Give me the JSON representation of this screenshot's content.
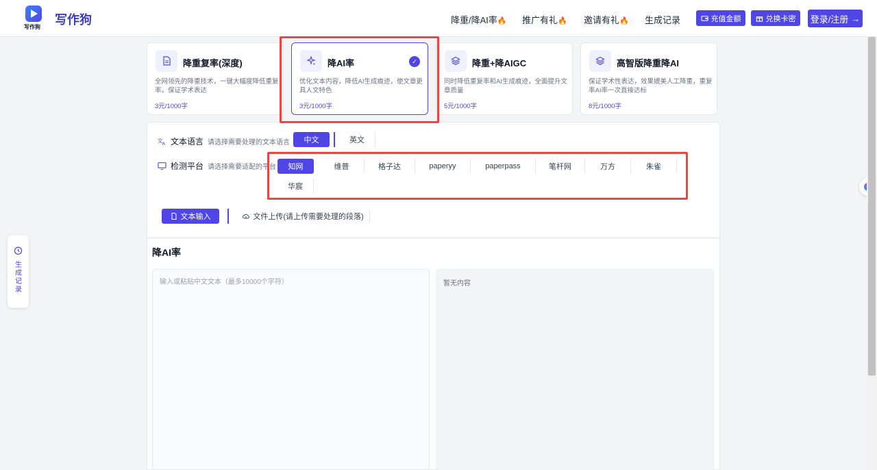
{
  "header": {
    "logo_text": "写作狗",
    "brand": "写作狗",
    "nav": [
      {
        "label": "降重/降AI率"
      },
      {
        "label": "推广有礼"
      },
      {
        "label": "邀请有礼"
      },
      {
        "label": "生成记录"
      }
    ],
    "recharge_label": "充值金额",
    "redeem_label": "兑换卡密",
    "login_label": "登录/注册"
  },
  "cards": [
    {
      "title": "降重复率(深度)",
      "desc": "全网领先的降重技术，一键大幅度降低重复率，保证学术表达",
      "price": "3元/1000字",
      "selected": false
    },
    {
      "title": "降AI率",
      "desc": "优化文本内容，降低AI生成痕迹，使文章更具人文特色",
      "price": "3元/1000字",
      "selected": true
    },
    {
      "title": "降重+降AIGC",
      "desc": "同时降低重复率和AI生成痕迹，全面提升文章质量",
      "price": "5元/1000字",
      "selected": false
    },
    {
      "title": "高智版降重降AI",
      "desc": "保证学术性表达，效果媲美人工降重，重复率AI率一次直接达标",
      "price": "8元/1000字",
      "selected": false
    }
  ],
  "language": {
    "label": "文本语言",
    "hint": "请选择需要处理的文本语言",
    "options": [
      "中文",
      "英文"
    ],
    "selected": "中文"
  },
  "platform": {
    "label": "检测平台",
    "hint": "请选择需要适配的平台",
    "options": [
      "知网",
      "维普",
      "格子达",
      "paperyy",
      "paperpass",
      "笔杆网",
      "万方",
      "朱雀",
      "华宸"
    ],
    "selected": "知网"
  },
  "mode": {
    "text_input": "文本输入",
    "file_upload": "文件上传(请上传需要处理的段落)"
  },
  "editor": {
    "title": "降AI率",
    "placeholder": "输入或粘贴中文文本（最多10000个字符）",
    "output_empty": "暂无内容"
  },
  "side_tab": {
    "label": "生成记录"
  },
  "colors": {
    "accent": "#4f46e5",
    "highlight": "#ef4444"
  }
}
